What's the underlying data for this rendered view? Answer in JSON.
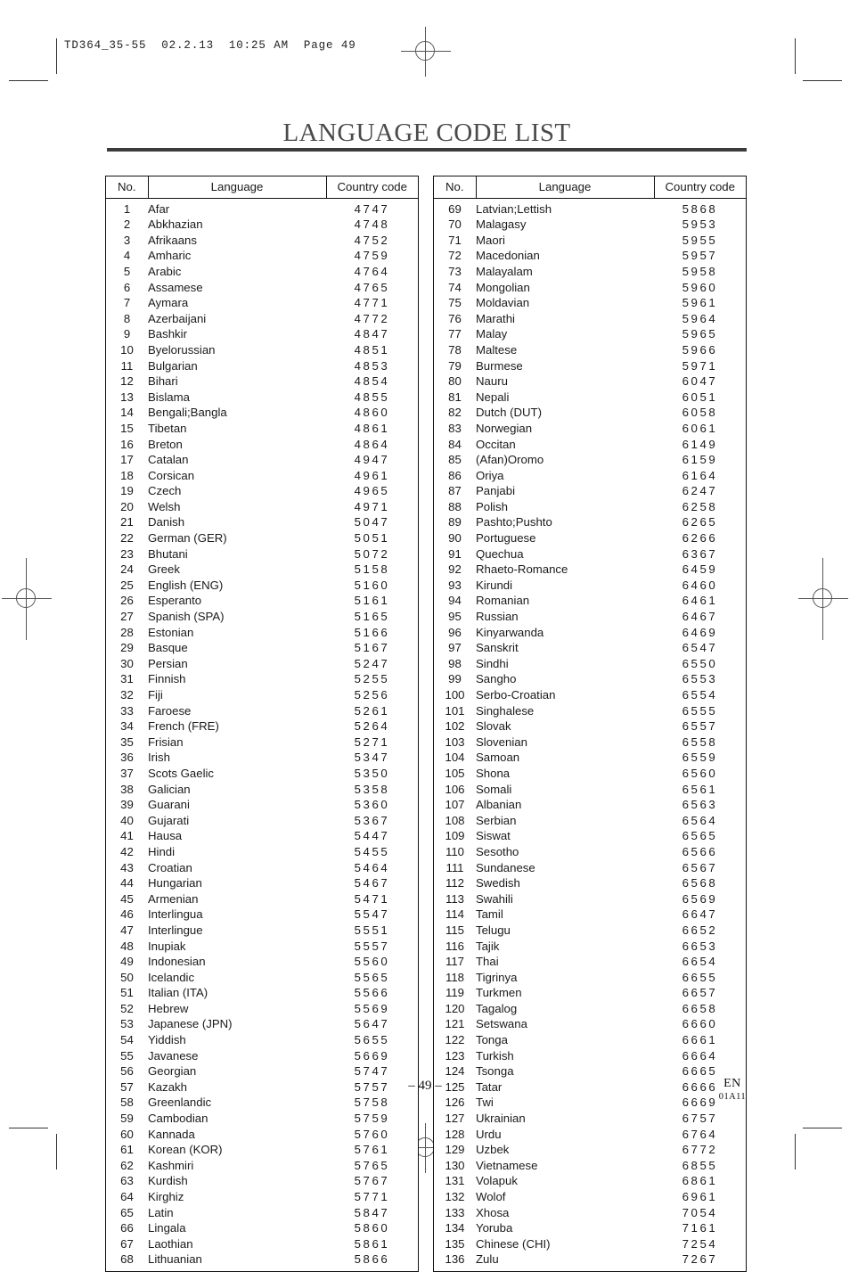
{
  "print_slug": "TD364_35-55  02.2.13  10:25 AM  Page 49",
  "title": "LANGUAGE CODE LIST",
  "table": {
    "headers": {
      "no": "No.",
      "language": "Language",
      "country_code": "Country code"
    }
  },
  "footer": {
    "page_number": "– 49 –",
    "region": "EN",
    "doc_code": "01A11"
  },
  "chart_data": {
    "type": "table",
    "title": "LANGUAGE CODE LIST",
    "columns": [
      "No.",
      "Language",
      "Country code"
    ],
    "left_column": [
      [
        1,
        "Afar",
        "4747"
      ],
      [
        2,
        "Abkhazian",
        "4748"
      ],
      [
        3,
        "Afrikaans",
        "4752"
      ],
      [
        4,
        "Amharic",
        "4759"
      ],
      [
        5,
        "Arabic",
        "4764"
      ],
      [
        6,
        "Assamese",
        "4765"
      ],
      [
        7,
        "Aymara",
        "4771"
      ],
      [
        8,
        "Azerbaijani",
        "4772"
      ],
      [
        9,
        "Bashkir",
        "4847"
      ],
      [
        10,
        "Byelorussian",
        "4851"
      ],
      [
        11,
        "Bulgarian",
        "4853"
      ],
      [
        12,
        "Bihari",
        "4854"
      ],
      [
        13,
        "Bislama",
        "4855"
      ],
      [
        14,
        "Bengali;Bangla",
        "4860"
      ],
      [
        15,
        "Tibetan",
        "4861"
      ],
      [
        16,
        "Breton",
        "4864"
      ],
      [
        17,
        "Catalan",
        "4947"
      ],
      [
        18,
        "Corsican",
        "4961"
      ],
      [
        19,
        "Czech",
        "4965"
      ],
      [
        20,
        "Welsh",
        "4971"
      ],
      [
        21,
        "Danish",
        "5047"
      ],
      [
        22,
        "German (GER)",
        "5051"
      ],
      [
        23,
        "Bhutani",
        "5072"
      ],
      [
        24,
        "Greek",
        "5158"
      ],
      [
        25,
        "English (ENG)",
        "5160"
      ],
      [
        26,
        "Esperanto",
        "5161"
      ],
      [
        27,
        "Spanish (SPA)",
        "5165"
      ],
      [
        28,
        "Estonian",
        "5166"
      ],
      [
        29,
        "Basque",
        "5167"
      ],
      [
        30,
        "Persian",
        "5247"
      ],
      [
        31,
        "Finnish",
        "5255"
      ],
      [
        32,
        "Fiji",
        "5256"
      ],
      [
        33,
        "Faroese",
        "5261"
      ],
      [
        34,
        "French (FRE)",
        "5264"
      ],
      [
        35,
        "Frisian",
        "5271"
      ],
      [
        36,
        "Irish",
        "5347"
      ],
      [
        37,
        "Scots Gaelic",
        "5350"
      ],
      [
        38,
        "Galician",
        "5358"
      ],
      [
        39,
        "Guarani",
        "5360"
      ],
      [
        40,
        "Gujarati",
        "5367"
      ],
      [
        41,
        "Hausa",
        "5447"
      ],
      [
        42,
        "Hindi",
        "5455"
      ],
      [
        43,
        "Croatian",
        "5464"
      ],
      [
        44,
        "Hungarian",
        "5467"
      ],
      [
        45,
        "Armenian",
        "5471"
      ],
      [
        46,
        "Interlingua",
        "5547"
      ],
      [
        47,
        "Interlingue",
        "5551"
      ],
      [
        48,
        "Inupiak",
        "5557"
      ],
      [
        49,
        "Indonesian",
        "5560"
      ],
      [
        50,
        "Icelandic",
        "5565"
      ],
      [
        51,
        "Italian (ITA)",
        "5566"
      ],
      [
        52,
        "Hebrew",
        "5569"
      ],
      [
        53,
        "Japanese (JPN)",
        "5647"
      ],
      [
        54,
        "Yiddish",
        "5655"
      ],
      [
        55,
        "Javanese",
        "5669"
      ],
      [
        56,
        "Georgian",
        "5747"
      ],
      [
        57,
        "Kazakh",
        "5757"
      ],
      [
        58,
        "Greenlandic",
        "5758"
      ],
      [
        59,
        "Cambodian",
        "5759"
      ],
      [
        60,
        "Kannada",
        "5760"
      ],
      [
        61,
        "Korean (KOR)",
        "5761"
      ],
      [
        62,
        "Kashmiri",
        "5765"
      ],
      [
        63,
        "Kurdish",
        "5767"
      ],
      [
        64,
        "Kirghiz",
        "5771"
      ],
      [
        65,
        "Latin",
        "5847"
      ],
      [
        66,
        "Lingala",
        "5860"
      ],
      [
        67,
        "Laothian",
        "5861"
      ],
      [
        68,
        "Lithuanian",
        "5866"
      ]
    ],
    "right_column": [
      [
        69,
        "Latvian;Lettish",
        "5868"
      ],
      [
        70,
        "Malagasy",
        "5953"
      ],
      [
        71,
        "Maori",
        "5955"
      ],
      [
        72,
        "Macedonian",
        "5957"
      ],
      [
        73,
        "Malayalam",
        "5958"
      ],
      [
        74,
        "Mongolian",
        "5960"
      ],
      [
        75,
        "Moldavian",
        "5961"
      ],
      [
        76,
        "Marathi",
        "5964"
      ],
      [
        77,
        "Malay",
        "5965"
      ],
      [
        78,
        "Maltese",
        "5966"
      ],
      [
        79,
        "Burmese",
        "5971"
      ],
      [
        80,
        "Nauru",
        "6047"
      ],
      [
        81,
        "Nepali",
        "6051"
      ],
      [
        82,
        "Dutch (DUT)",
        "6058"
      ],
      [
        83,
        "Norwegian",
        "6061"
      ],
      [
        84,
        "Occitan",
        "6149"
      ],
      [
        85,
        "(Afan)Oromo",
        "6159"
      ],
      [
        86,
        "Oriya",
        "6164"
      ],
      [
        87,
        "Panjabi",
        "6247"
      ],
      [
        88,
        "Polish",
        "6258"
      ],
      [
        89,
        "Pashto;Pushto",
        "6265"
      ],
      [
        90,
        "Portuguese",
        "6266"
      ],
      [
        91,
        "Quechua",
        "6367"
      ],
      [
        92,
        "Rhaeto-Romance",
        "6459"
      ],
      [
        93,
        "Kirundi",
        "6460"
      ],
      [
        94,
        "Romanian",
        "6461"
      ],
      [
        95,
        "Russian",
        "6467"
      ],
      [
        96,
        "Kinyarwanda",
        "6469"
      ],
      [
        97,
        "Sanskrit",
        "6547"
      ],
      [
        98,
        "Sindhi",
        "6550"
      ],
      [
        99,
        "Sangho",
        "6553"
      ],
      [
        100,
        "Serbo-Croatian",
        "6554"
      ],
      [
        101,
        "Singhalese",
        "6555"
      ],
      [
        102,
        "Slovak",
        "6557"
      ],
      [
        103,
        "Slovenian",
        "6558"
      ],
      [
        104,
        "Samoan",
        "6559"
      ],
      [
        105,
        "Shona",
        "6560"
      ],
      [
        106,
        "Somali",
        "6561"
      ],
      [
        107,
        "Albanian",
        "6563"
      ],
      [
        108,
        "Serbian",
        "6564"
      ],
      [
        109,
        "Siswat",
        "6565"
      ],
      [
        110,
        "Sesotho",
        "6566"
      ],
      [
        111,
        "Sundanese",
        "6567"
      ],
      [
        112,
        "Swedish",
        "6568"
      ],
      [
        113,
        "Swahili",
        "6569"
      ],
      [
        114,
        "Tamil",
        "6647"
      ],
      [
        115,
        "Telugu",
        "6652"
      ],
      [
        116,
        "Tajik",
        "6653"
      ],
      [
        117,
        "Thai",
        "6654"
      ],
      [
        118,
        "Tigrinya",
        "6655"
      ],
      [
        119,
        "Turkmen",
        "6657"
      ],
      [
        120,
        "Tagalog",
        "6658"
      ],
      [
        121,
        "Setswana",
        "6660"
      ],
      [
        122,
        "Tonga",
        "6661"
      ],
      [
        123,
        "Turkish",
        "6664"
      ],
      [
        124,
        "Tsonga",
        "6665"
      ],
      [
        125,
        "Tatar",
        "6666"
      ],
      [
        126,
        "Twi",
        "6669"
      ],
      [
        127,
        "Ukrainian",
        "6757"
      ],
      [
        128,
        "Urdu",
        "6764"
      ],
      [
        129,
        "Uzbek",
        "6772"
      ],
      [
        130,
        "Vietnamese",
        "6855"
      ],
      [
        131,
        "Volapuk",
        "6861"
      ],
      [
        132,
        "Wolof",
        "6961"
      ],
      [
        133,
        "Xhosa",
        "7054"
      ],
      [
        134,
        "Yoruba",
        "7161"
      ],
      [
        135,
        "Chinese (CHI)",
        "7254"
      ],
      [
        136,
        "Zulu",
        "7267"
      ]
    ]
  }
}
